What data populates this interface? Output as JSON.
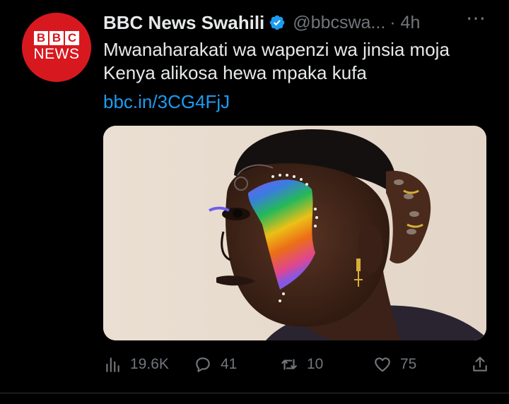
{
  "account": {
    "name": "BBC News Swahili",
    "handle": "@bbcswa...",
    "time": "· 4h",
    "avatar": {
      "logo_letters": [
        "B",
        "B",
        "C"
      ],
      "logo_word": "NEWS"
    }
  },
  "tweet": {
    "text_line1": "Mwanaharakati wa wapenzi wa jinsia moja",
    "text_line2": "Kenya alikosa hewa mpaka kufa",
    "link": "bbc.in/3CG4FjJ"
  },
  "more_icon": "⋯",
  "actions": {
    "views": "19.6K",
    "replies": "41",
    "retweets": "10",
    "likes": "75"
  },
  "colors": {
    "background": "#000000",
    "text": "#e7e9ea",
    "muted": "#71767b",
    "link": "#1d9bf0",
    "avatar_red": "#d7191f"
  },
  "icons": [
    "verified-badge-icon",
    "more-icon",
    "views-icon",
    "reply-icon",
    "retweet-icon",
    "like-icon",
    "share-icon"
  ]
}
